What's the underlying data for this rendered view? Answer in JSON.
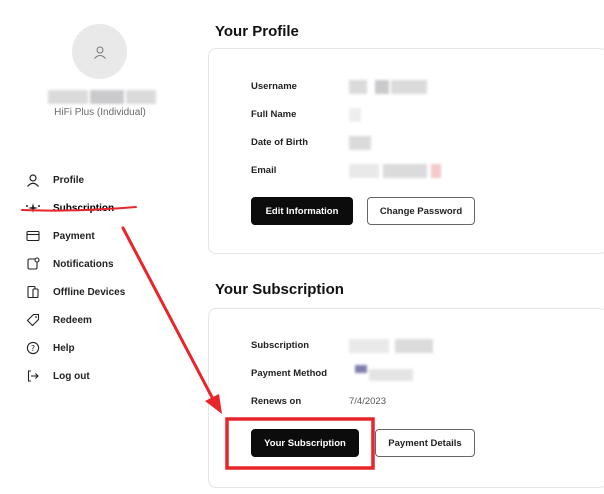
{
  "sidebar": {
    "plan": "HiFi Plus (Individual)",
    "items": [
      {
        "label": "Profile",
        "icon": "user-icon"
      },
      {
        "label": "Subscription",
        "icon": "sparkle-icon"
      },
      {
        "label": "Payment",
        "icon": "credit-card-icon"
      },
      {
        "label": "Notifications",
        "icon": "bell-icon"
      },
      {
        "label": "Offline Devices",
        "icon": "devices-icon"
      },
      {
        "label": "Redeem",
        "icon": "tag-icon"
      },
      {
        "label": "Help",
        "icon": "help-icon"
      },
      {
        "label": "Log out",
        "icon": "logout-icon"
      }
    ]
  },
  "profile": {
    "title": "Your Profile",
    "labels": {
      "username": "Username",
      "full_name": "Full Name",
      "dob": "Date of Birth",
      "email": "Email"
    },
    "buttons": {
      "edit": "Edit Information",
      "password": "Change Password"
    }
  },
  "subscription": {
    "title": "Your Subscription",
    "labels": {
      "subscription": "Subscription",
      "payment_method": "Payment Method",
      "renews_on": "Renews on"
    },
    "renews_value": "7/4/2023",
    "buttons": {
      "your_subscription": "Your Subscription",
      "payment_details": "Payment Details"
    }
  },
  "colors": {
    "annotation": "#e8252a",
    "button_dark": "#0c0c0c"
  }
}
